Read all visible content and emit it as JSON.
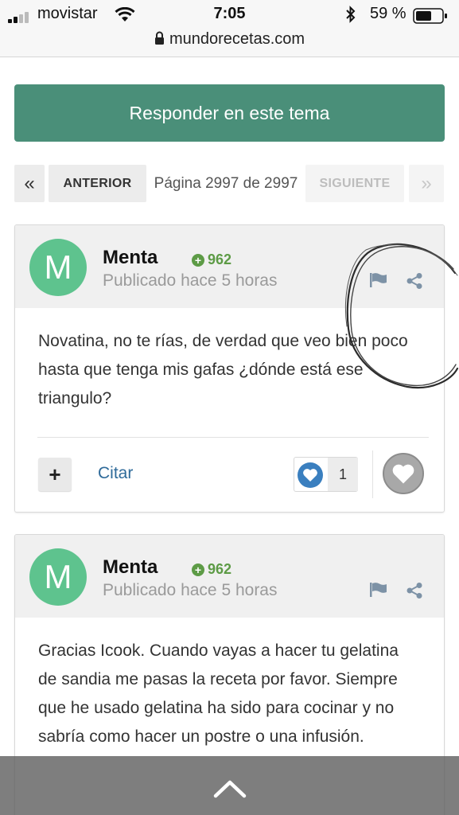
{
  "status_bar": {
    "carrier": "movistar",
    "time": "7:05",
    "battery_percent": "59 %",
    "url": "mundorecetas.com"
  },
  "actions": {
    "reply_label": "Responder en este tema"
  },
  "pagination": {
    "first_symbol": "«",
    "prev_label": "ANTERIOR",
    "page_info": "Página 2997 de 2997",
    "next_label": "SIGUIENTE",
    "last_symbol": "»"
  },
  "posts": [
    {
      "avatar_letter": "M",
      "author": "Menta",
      "reputation": "962",
      "published": "Publicado hace 5 horas",
      "body": "Novatina, no te rías, de verdad que veo bien poco hasta que tenga mis gafas ¿dónde está ese triangulo?",
      "quote_label": "Citar",
      "like_count": "1"
    },
    {
      "avatar_letter": "M",
      "author": "Menta",
      "reputation": "962",
      "published": "Publicado hace 5 horas",
      "body": "Gracias Icook. Cuando vayas a hacer tu gelatina de sandia me pasas la receta por favor. Siempre que he usado gelatina ha sido para cocinar y no sabría como hacer un postre o una infusión."
    }
  ],
  "colors": {
    "accent_green": "#4a8f79",
    "avatar_green": "#5ec38e",
    "reputation_green": "#5d9b46",
    "link_blue": "#2f6b9a",
    "like_blue": "#3a7fbf"
  },
  "icons": [
    "signal-icon",
    "wifi-icon",
    "bluetooth-icon",
    "battery-icon",
    "lock-icon",
    "flag-icon",
    "share-icon",
    "heart-icon",
    "chevron-up-icon"
  ]
}
